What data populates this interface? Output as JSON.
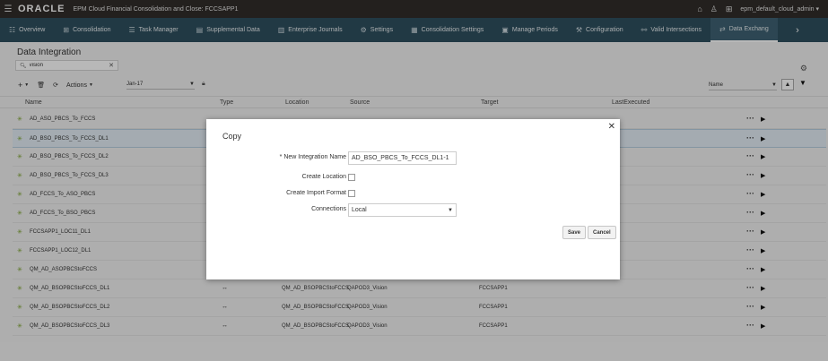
{
  "header": {
    "logo": "ORACLE",
    "app_title": "EPM Cloud Financial Consolidation and Close: FCCSAPP1",
    "user": "epm_default_cloud_admin"
  },
  "nav": {
    "items": [
      {
        "label": "Overview",
        "icon": "☷"
      },
      {
        "label": "Consolidation",
        "icon": "⊞"
      },
      {
        "label": "Task Manager",
        "icon": "☰"
      },
      {
        "label": "Supplemental Data",
        "icon": "▤"
      },
      {
        "label": "Enterprise Journals",
        "icon": "▥"
      },
      {
        "label": "Settings",
        "icon": "⚙"
      },
      {
        "label": "Consolidation Settings",
        "icon": "▦"
      },
      {
        "label": "Manage Periods",
        "icon": "▣"
      },
      {
        "label": "Configuration",
        "icon": "⚒"
      },
      {
        "label": "Valid Intersections",
        "icon": "⚯"
      },
      {
        "label": "Data Exchang",
        "icon": "⇄"
      }
    ]
  },
  "page": {
    "title": "Data Integration",
    "search_value": "vision",
    "actions_label": "Actions",
    "period_value": "Jan-17",
    "sort_value": "Name"
  },
  "table": {
    "columns": {
      "name": "Name",
      "type": "Type",
      "location": "Location",
      "source": "Source",
      "target": "Target",
      "last_executed": "LastExecuted"
    },
    "rows": [
      {
        "name": "AD_ASO_PBCS_To_FCCS",
        "type": "",
        "location": "",
        "source": "",
        "target": ""
      },
      {
        "name": "AD_BSO_PBCS_To_FCCS_DL1",
        "type": "",
        "location": "",
        "source": "",
        "target": ""
      },
      {
        "name": "AD_BSO_PBCS_To_FCCS_DL2",
        "type": "",
        "location": "",
        "source": "",
        "target": ""
      },
      {
        "name": "AD_BSO_PBCS_To_FCCS_DL3",
        "type": "",
        "location": "",
        "source": "",
        "target": ""
      },
      {
        "name": "AD_FCCS_To_ASO_PBCS",
        "type": "",
        "location": "",
        "source": "",
        "target": ""
      },
      {
        "name": "AD_FCCS_To_BSO_PBCS",
        "type": "",
        "location": "",
        "source": "",
        "target": ""
      },
      {
        "name": "FCCSAPP1_LOC11_DL1",
        "type": "",
        "location": "",
        "source": "",
        "target": ""
      },
      {
        "name": "FCCSAPP1_LOC12_DL1",
        "type": "",
        "location": "",
        "source": "",
        "target": ""
      },
      {
        "name": "QM_AD_ASOPBCStoFCCS",
        "type": "",
        "location": "",
        "source": "",
        "target": ""
      },
      {
        "name": "QM_AD_BSOPBCStoFCCS_DL1",
        "type": "↔",
        "location": "QM_AD_BSOPBCStoFCCS",
        "source": "QAPOD3_Vision",
        "target": "FCCSAPP1"
      },
      {
        "name": "QM_AD_BSOPBCStoFCCS_DL2",
        "type": "↔",
        "location": "QM_AD_BSOPBCStoFCCS",
        "source": "QAPOD3_Vision",
        "target": "FCCSAPP1"
      },
      {
        "name": "QM_AD_BSOPBCStoFCCS_DL3",
        "type": "↔",
        "location": "QM_AD_BSOPBCStoFCCS",
        "source": "QAPOD3_Vision",
        "target": "FCCSAPP1"
      }
    ]
  },
  "modal": {
    "title": "Copy",
    "integration_name_label": "New Integration Name",
    "integration_name_value": "AD_BSO_PBCS_To_FCCS_DL1-1",
    "create_location_label": "Create Location",
    "create_import_format_label": "Create Import Format",
    "connections_label": "Connections",
    "connections_value": "Local",
    "save_label": "Save",
    "cancel_label": "Cancel"
  }
}
